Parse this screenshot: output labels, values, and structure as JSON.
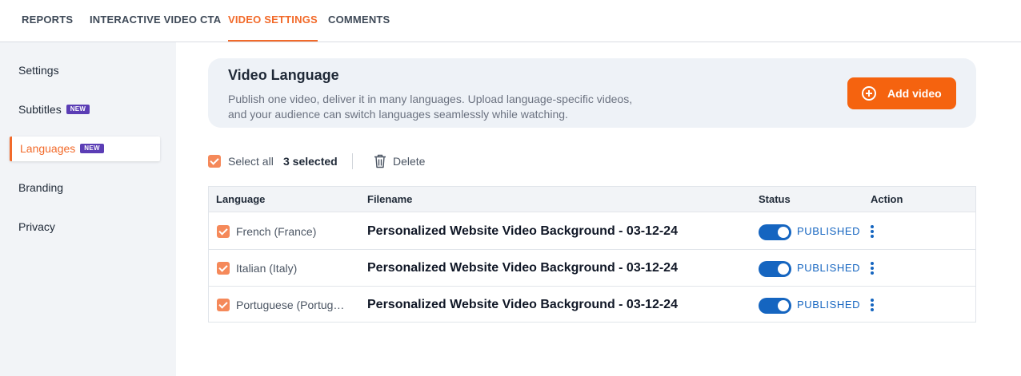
{
  "tabs": [
    {
      "label": "REPORTS",
      "active": false
    },
    {
      "label": "INTERACTIVE VIDEO CTA",
      "active": false
    },
    {
      "label": "VIDEO SETTINGS",
      "active": true
    },
    {
      "label": "COMMENTS",
      "active": false
    }
  ],
  "sidebar": {
    "items": [
      {
        "label": "Settings",
        "badge": ""
      },
      {
        "label": "Subtitles",
        "badge": "NEW"
      },
      {
        "label": "Languages",
        "badge": "NEW",
        "active": true
      },
      {
        "label": "Branding",
        "badge": ""
      },
      {
        "label": "Privacy",
        "badge": ""
      }
    ]
  },
  "card": {
    "title": "Video Language",
    "description": "Publish one video, deliver it in many languages. Upload language-specific videos, and your audience can switch languages seamlessly while watching.",
    "add_button": "Add video",
    "add_icon": "plus-circle-icon"
  },
  "toolbar": {
    "select_all": "Select all",
    "selected_count": "3 selected",
    "delete": "Delete",
    "delete_icon": "trash-icon"
  },
  "table": {
    "headers": {
      "language": "Language",
      "filename": "Filename",
      "status": "Status",
      "action": "Action"
    },
    "rows": [
      {
        "language": "French (France)",
        "filename": "Personalized Website Video Background - 03-12-24",
        "status": "PUBLISHED",
        "checked": true,
        "enabled": true
      },
      {
        "language": "Italian (Italy)",
        "filename": "Personalized Website Video Background - 03-12-24",
        "status": "PUBLISHED",
        "checked": true,
        "enabled": true
      },
      {
        "language": "Portuguese (Portug…",
        "filename": "Personalized Website Video Background - 03-12-24",
        "status": "PUBLISHED",
        "checked": true,
        "enabled": true
      }
    ]
  },
  "colors": {
    "accent": "#f26a2a",
    "button": "#f5630f",
    "badge": "#5b3db5",
    "toggle": "#1565c0",
    "checkbox": "#f5895a"
  }
}
